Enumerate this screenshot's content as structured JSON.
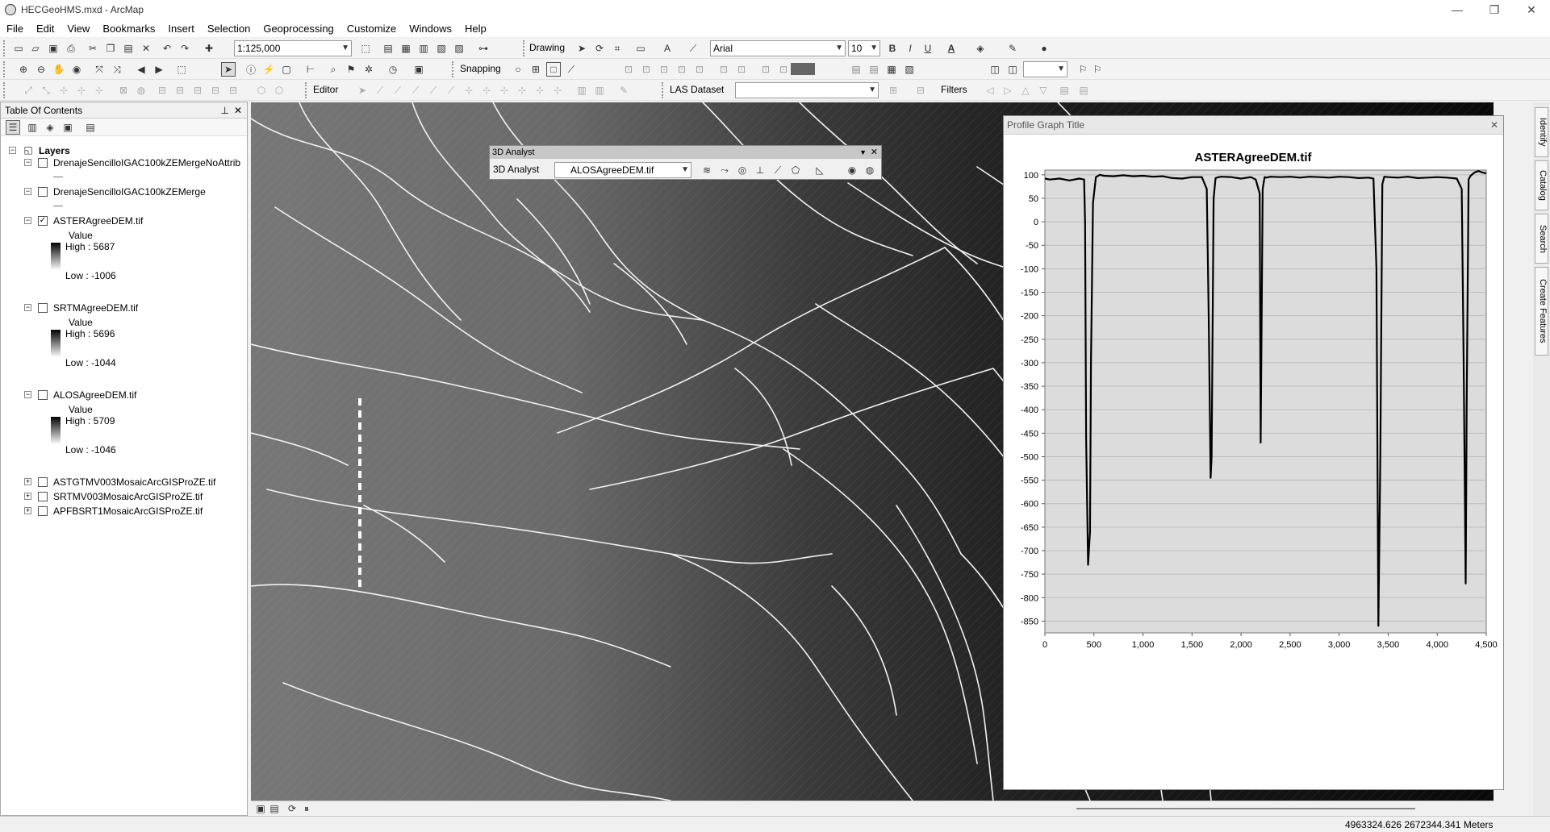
{
  "window": {
    "title": "HECGeoHMS.mxd - ArcMap",
    "min": "—",
    "max": "❐",
    "close": "✕"
  },
  "menu": [
    "File",
    "Edit",
    "View",
    "Bookmarks",
    "Insert",
    "Selection",
    "Geoprocessing",
    "Customize",
    "Windows",
    "Help"
  ],
  "toolbar1": {
    "scale": "1:125,000",
    "drawing_label": "Drawing",
    "font_name": "Arial",
    "font_size": "10",
    "bold": "B",
    "italic": "I",
    "underline": "U",
    "font_color": "A"
  },
  "toolbar2": {
    "snapping_label": "Snapping"
  },
  "toolbar3": {
    "editor_label": "Editor",
    "las_label": "LAS Dataset",
    "filters_label": "Filters"
  },
  "toc": {
    "title": "Table Of Contents",
    "pin": "⊥",
    "close": "✕",
    "root": "Layers",
    "layers": [
      {
        "name": "DrenajeSencilloIGAC100kZEMergeNoAttrib",
        "checked": false,
        "type": "line"
      },
      {
        "name": "DrenajeSencilloIGAC100kZEMerge",
        "checked": false,
        "type": "line"
      },
      {
        "name": "ASTERAgreeDEM.tif",
        "checked": true,
        "type": "raster",
        "value_label": "Value",
        "high": "High : 5687",
        "low": "Low : -1006"
      },
      {
        "name": "SRTMAgreeDEM.tif",
        "checked": false,
        "type": "raster",
        "value_label": "Value",
        "high": "High : 5696",
        "low": "Low : -1044"
      },
      {
        "name": "ALOSAgreeDEM.tif",
        "checked": false,
        "type": "raster",
        "value_label": "Value",
        "high": "High : 5709",
        "low": "Low : -1046"
      },
      {
        "name": "ASTGTMV003MosaicArcGISProZE.tif",
        "checked": false,
        "type": "collapsed"
      },
      {
        "name": "SRTMV003MosaicArcGISProZE.tif",
        "checked": false,
        "type": "collapsed"
      },
      {
        "name": "APFBSRT1MosaicArcGISProZE.tif",
        "checked": false,
        "type": "collapsed"
      }
    ]
  },
  "analyst": {
    "caption": "3D Analyst",
    "menu_label": "3D Analyst",
    "layer": "ALOSAgreeDEM.tif"
  },
  "profile": {
    "window_title": "Profile Graph Title",
    "close": "✕"
  },
  "chart_data": {
    "type": "line",
    "title": "ASTERAgreeDEM.tif",
    "xlabel": "",
    "ylabel": "",
    "xlim": [
      0,
      4500
    ],
    "ylim": [
      -875,
      110
    ],
    "x_ticks": [
      "0",
      "500",
      "1,000",
      "1,500",
      "2,000",
      "2,500",
      "3,000",
      "3,500",
      "4,000",
      "4,500"
    ],
    "y_ticks": [
      "100",
      "50",
      "0",
      "-50",
      "-100",
      "-150",
      "-200",
      "-250",
      "-300",
      "-350",
      "-400",
      "-450",
      "-500",
      "-550",
      "-600",
      "-650",
      "-700",
      "-750",
      "-800",
      "-850"
    ],
    "grid": true,
    "series": [
      {
        "x": [
          0,
          50,
          150,
          250,
          350,
          400,
          410,
          420,
          440,
          460,
          470,
          490,
          520,
          560,
          600,
          700,
          800,
          900,
          1000,
          1100,
          1200,
          1300,
          1400,
          1500,
          1600,
          1650,
          1670,
          1690,
          1700,
          1720,
          1740,
          1770,
          1800,
          1900,
          2000,
          2100,
          2150,
          2190,
          2200,
          2220,
          2240,
          2260,
          2300,
          2400,
          2500,
          2600,
          2700,
          2800,
          2900,
          3000,
          3100,
          3200,
          3300,
          3350,
          3380,
          3400,
          3420,
          3440,
          3460,
          3500,
          3600,
          3700,
          3800,
          3900,
          4000,
          4100,
          4200,
          4250,
          4270,
          4290,
          4300,
          4320,
          4340,
          4380,
          4420,
          4460,
          4500
        ],
        "y": [
          92,
          90,
          92,
          88,
          92,
          90,
          0,
          -460,
          -730,
          -660,
          -300,
          40,
          95,
          100,
          98,
          97,
          99,
          97,
          98,
          96,
          97,
          93,
          92,
          95,
          95,
          70,
          -200,
          -545,
          -500,
          50,
          93,
          95,
          96,
          95,
          92,
          95,
          90,
          60,
          -470,
          70,
          95,
          94,
          96,
          95,
          96,
          94,
          96,
          95,
          94,
          96,
          95,
          93,
          94,
          92,
          -100,
          -860,
          -500,
          80,
          96,
          95,
          94,
          96,
          93,
          94,
          95,
          94,
          92,
          70,
          -300,
          -770,
          -400,
          90,
          98,
          105,
          108,
          105,
          103
        ]
      }
    ]
  },
  "status": {
    "coords": "4963324.626  2672344.341 Meters"
  }
}
